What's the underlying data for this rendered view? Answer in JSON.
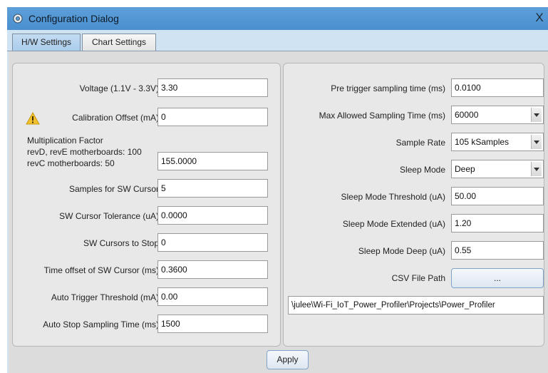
{
  "window": {
    "title": "Configuration Dialog",
    "close_label": "X"
  },
  "tabs": [
    {
      "label": "H/W Settings",
      "active": true
    },
    {
      "label": "Chart Settings",
      "active": false
    }
  ],
  "hw": {
    "voltage": {
      "label": "Voltage (1.1V - 3.3V)",
      "value": "3.30"
    },
    "calibration_offset": {
      "label": "Calibration Offset (mA)",
      "value": "0",
      "icon": "warning-icon"
    },
    "multiplication_factor": {
      "label_lines": [
        "Multiplication Factor",
        "revD, revE motherboards: 100",
        "revC motherboards: 50"
      ],
      "value": "155.0000"
    },
    "samples_sw_cursor": {
      "label": "Samples for SW Cursor",
      "value": "5"
    },
    "sw_cursor_tolerance": {
      "label": "SW Cursor Tolerance (uA)",
      "value": "0.0000"
    },
    "sw_cursors_to_stop": {
      "label": "SW Cursors to Stop",
      "value": "0"
    },
    "time_offset_sw_cursor": {
      "label": "Time offset of SW Cursor (ms)",
      "value": "0.3600"
    },
    "auto_trigger_threshold": {
      "label": "Auto Trigger Threshold (mA)",
      "value": "0.00"
    },
    "auto_stop_sampling_time": {
      "label": "Auto Stop Sampling Time (ms)",
      "value": "1500"
    }
  },
  "sampling": {
    "pre_trigger_time": {
      "label": "Pre trigger sampling time (ms)",
      "value": "0.0100"
    },
    "max_sampling_time": {
      "label": "Max Allowed Sampling Time (ms)",
      "value": "60000"
    },
    "sample_rate": {
      "label": "Sample Rate",
      "value": "105 kSamples"
    },
    "sleep_mode": {
      "label": "Sleep Mode",
      "value": "Deep"
    },
    "sleep_mode_threshold": {
      "label": "Sleep Mode Threshold (uA)",
      "value": "50.00"
    },
    "sleep_mode_extended": {
      "label": "Sleep Mode Extended (uA)",
      "value": "1.20"
    },
    "sleep_mode_deep": {
      "label": "Sleep Mode Deep (uA)",
      "value": "0.55"
    },
    "csv_file_path": {
      "label": "CSV File Path",
      "browse_label": "...",
      "value": "\\julee\\Wi-Fi_IoT_Power_Profiler\\Projects\\Power_Profiler"
    }
  },
  "footer": {
    "apply_label": "Apply"
  },
  "colors": {
    "titlebar": "#4a8fcf",
    "window_bg": "#cfe3f3",
    "panel_bg": "#e8e8e8",
    "warning": "#f2c12e"
  }
}
